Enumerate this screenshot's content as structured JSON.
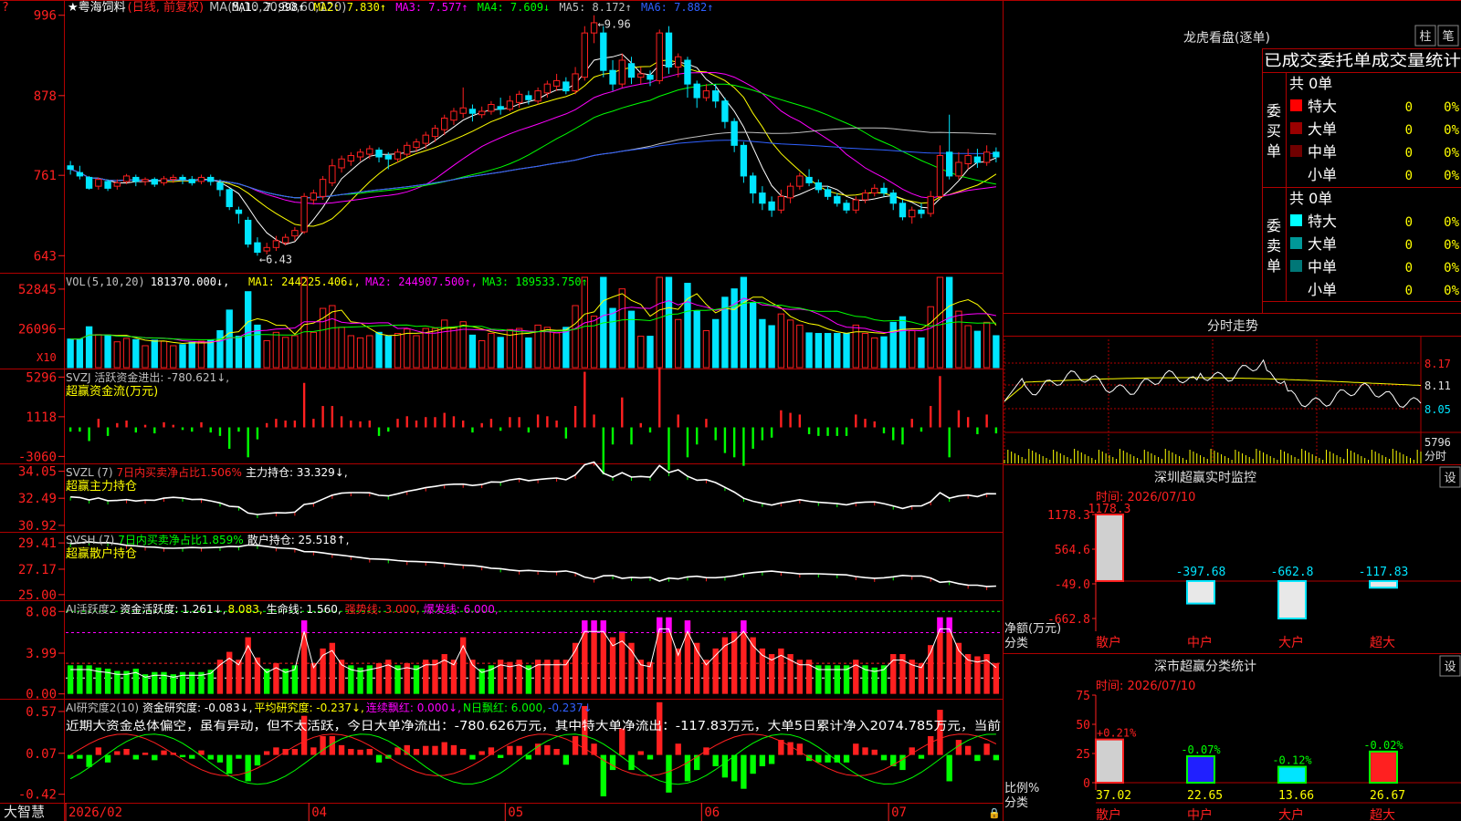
{
  "colors": {
    "up": "#ff2020",
    "down": "#00e5ff",
    "grid": "#b00000",
    "text": "#c0c0c0",
    "yellow": "#ffff00",
    "magenta": "#ff00ff",
    "green": "#00ff00",
    "blue": "#3060ff",
    "white": "#ffffff"
  },
  "main_chart": {
    "title_star": "★",
    "name": "粤海饲料",
    "mode": "(日线, 前复权)",
    "ma_header": "MA(5,10,20,30,60,120)",
    "ma_values": [
      {
        "label": "MA1: 7.998↑",
        "color": "#ffffff"
      },
      {
        "label": "MA2: 7.830↑",
        "color": "#ffff00"
      },
      {
        "label": "MA3: 7.577↑",
        "color": "#ff00ff"
      },
      {
        "label": "MA4: 7.609↓",
        "color": "#00ff00"
      },
      {
        "label": "MA5: 8.172↑",
        "color": "#c0c0c0"
      },
      {
        "label": "MA6: 7.882↑",
        "color": "#3060ff"
      }
    ],
    "y_ticks": [
      "996",
      "878",
      "761",
      "643"
    ],
    "y_values": [
      9.96,
      8.78,
      7.61,
      6.43
    ],
    "high_label": "9.96",
    "low_label": "6.43",
    "candles": [
      [
        7.75,
        7.7,
        7.82,
        7.62
      ],
      [
        7.65,
        7.6,
        7.75,
        7.55
      ],
      [
        7.58,
        7.42,
        7.6,
        7.4
      ],
      [
        7.45,
        7.55,
        7.58,
        7.4
      ],
      [
        7.52,
        7.42,
        7.55,
        7.38
      ],
      [
        7.45,
        7.5,
        7.55,
        7.4
      ],
      [
        7.52,
        7.6,
        7.63,
        7.48
      ],
      [
        7.58,
        7.52,
        7.62,
        7.45
      ],
      [
        7.52,
        7.55,
        7.58,
        7.46
      ],
      [
        7.55,
        7.48,
        7.58,
        7.44
      ],
      [
        7.5,
        7.56,
        7.6,
        7.46
      ],
      [
        7.55,
        7.58,
        7.62,
        7.5
      ],
      [
        7.58,
        7.55,
        7.62,
        7.48
      ],
      [
        7.55,
        7.5,
        7.6,
        7.46
      ],
      [
        7.52,
        7.58,
        7.62,
        7.48
      ],
      [
        7.58,
        7.52,
        7.62,
        7.46
      ],
      [
        7.5,
        7.4,
        7.55,
        7.3
      ],
      [
        7.4,
        7.15,
        7.42,
        7.1
      ],
      [
        7.1,
        7.05,
        7.15,
        6.9
      ],
      [
        6.95,
        6.6,
        7.0,
        6.55
      ],
      [
        6.62,
        6.48,
        6.7,
        6.43
      ],
      [
        6.5,
        6.55,
        6.62,
        6.45
      ],
      [
        6.55,
        6.65,
        6.72,
        6.5
      ],
      [
        6.62,
        6.7,
        6.75,
        6.58
      ],
      [
        6.72,
        6.8,
        6.85,
        6.65
      ],
      [
        6.78,
        7.3,
        7.35,
        6.75
      ],
      [
        7.25,
        7.35,
        7.4,
        7.18
      ],
      [
        7.3,
        7.55,
        7.6,
        7.25
      ],
      [
        7.5,
        7.75,
        7.85,
        7.45
      ],
      [
        7.72,
        7.85,
        7.9,
        7.65
      ],
      [
        7.82,
        7.9,
        7.95,
        7.75
      ],
      [
        7.88,
        7.95,
        8.0,
        7.82
      ],
      [
        7.92,
        8.0,
        8.05,
        7.85
      ],
      [
        7.98,
        7.88,
        8.02,
        7.8
      ],
      [
        7.9,
        7.85,
        7.95,
        7.7
      ],
      [
        7.85,
        7.95,
        8.0,
        7.8
      ],
      [
        7.92,
        8.05,
        8.1,
        7.88
      ],
      [
        8.02,
        8.1,
        8.15,
        7.95
      ],
      [
        8.08,
        8.2,
        8.25,
        8.0
      ],
      [
        8.18,
        8.3,
        8.35,
        8.1
      ],
      [
        8.28,
        8.45,
        8.5,
        8.2
      ],
      [
        8.42,
        8.55,
        8.6,
        8.35
      ],
      [
        8.52,
        8.6,
        8.9,
        8.45
      ],
      [
        8.58,
        8.52,
        8.65,
        8.4
      ],
      [
        8.5,
        8.55,
        8.62,
        8.45
      ],
      [
        8.55,
        8.65,
        8.7,
        8.5
      ],
      [
        8.62,
        8.58,
        8.75,
        8.5
      ],
      [
        8.58,
        8.7,
        8.78,
        8.55
      ],
      [
        8.68,
        8.8,
        8.85,
        8.6
      ],
      [
        8.78,
        8.72,
        8.85,
        8.65
      ],
      [
        8.7,
        8.85,
        8.9,
        8.65
      ],
      [
        8.82,
        8.95,
        9.0,
        8.75
      ],
      [
        8.92,
        9.0,
        9.1,
        8.85
      ],
      [
        8.98,
        8.85,
        9.05,
        8.8
      ],
      [
        8.85,
        9.1,
        9.2,
        8.8
      ],
      [
        9.05,
        9.7,
        9.8,
        9.0
      ],
      [
        9.7,
        9.85,
        9.96,
        9.55
      ],
      [
        9.7,
        9.15,
        9.8,
        9.05
      ],
      [
        9.15,
        8.95,
        9.3,
        8.85
      ],
      [
        8.95,
        9.3,
        9.4,
        8.9
      ],
      [
        9.25,
        9.05,
        9.35,
        8.95
      ],
      [
        9.05,
        9.1,
        9.2,
        8.95
      ],
      [
        9.08,
        9.02,
        9.15,
        8.92
      ],
      [
        9.0,
        9.7,
        9.75,
        8.95
      ],
      [
        9.7,
        9.2,
        9.8,
        9.1
      ],
      [
        9.2,
        9.35,
        9.4,
        9.05
      ],
      [
        9.3,
        8.95,
        9.35,
        8.75
      ],
      [
        8.95,
        8.75,
        9.0,
        8.6
      ],
      [
        8.75,
        8.85,
        8.95,
        8.7
      ],
      [
        8.85,
        8.7,
        8.95,
        8.6
      ],
      [
        8.7,
        8.4,
        8.75,
        8.3
      ],
      [
        8.4,
        8.05,
        8.45,
        7.95
      ],
      [
        8.05,
        7.6,
        8.1,
        7.5
      ],
      [
        7.6,
        7.35,
        7.65,
        7.2
      ],
      [
        7.35,
        7.2,
        7.45,
        7.1
      ],
      [
        7.22,
        7.1,
        7.3,
        7.0
      ],
      [
        7.1,
        7.3,
        7.4,
        7.05
      ],
      [
        7.28,
        7.45,
        7.5,
        7.2
      ],
      [
        7.45,
        7.6,
        7.65,
        7.4
      ],
      [
        7.58,
        7.5,
        7.7,
        7.45
      ],
      [
        7.5,
        7.4,
        7.55,
        7.35
      ],
      [
        7.4,
        7.3,
        7.45,
        7.25
      ],
      [
        7.3,
        7.2,
        7.35,
        7.15
      ],
      [
        7.2,
        7.1,
        7.25,
        7.05
      ],
      [
        7.1,
        7.25,
        7.3,
        7.05
      ],
      [
        7.25,
        7.35,
        7.4,
        7.2
      ],
      [
        7.35,
        7.42,
        7.48,
        7.3
      ],
      [
        7.42,
        7.35,
        7.5,
        7.3
      ],
      [
        7.35,
        7.2,
        7.4,
        7.1
      ],
      [
        7.2,
        7.0,
        7.25,
        6.95
      ],
      [
        7.0,
        7.1,
        7.15,
        6.9
      ],
      [
        7.1,
        7.05,
        7.2,
        6.98
      ],
      [
        7.05,
        7.3,
        7.38,
        7.0
      ],
      [
        7.3,
        7.9,
        8.05,
        7.25
      ],
      [
        7.95,
        7.6,
        8.5,
        7.55
      ],
      [
        7.6,
        7.8,
        7.95,
        7.55
      ],
      [
        7.78,
        7.9,
        8.0,
        7.7
      ],
      [
        7.88,
        7.8,
        8.0,
        7.72
      ],
      [
        7.8,
        7.95,
        8.05,
        7.75
      ],
      [
        7.95,
        7.88,
        8.02,
        7.8
      ]
    ],
    "price_range": [
      6.3,
      10.05
    ],
    "x_labels": [
      {
        "text": "2026/02",
        "i": 0
      },
      {
        "text": "04",
        "i": 26
      },
      {
        "text": "05",
        "i": 47
      },
      {
        "text": "06",
        "i": 68
      },
      {
        "text": "07",
        "i": 88
      }
    ],
    "x_bottom_left": "大智慧"
  },
  "vol_panel": {
    "header_label": "VOL(5,10,20)",
    "value": "181370.000↓,",
    "ma": [
      {
        "label": "MA1: 244225.406↓,",
        "color": "#ffff00"
      },
      {
        "label": "MA2: 244907.500↑,",
        "color": "#ff00ff"
      },
      {
        "label": "MA3: 189533.750↑",
        "color": "#00ff00"
      }
    ],
    "y_ticks": [
      "52845",
      "26096"
    ],
    "y_values": [
      52845,
      26096
    ],
    "unit": "X10",
    "max": 62000
  },
  "svzj_panel": {
    "header": "SVZJ  活跃资金进出: -780.621↓,",
    "subtitle": "超赢资金流(万元)",
    "y_ticks": [
      "5296",
      "1118",
      "-3060"
    ],
    "y_values": [
      5296,
      1118,
      -3060
    ],
    "range": [
      -3600,
      6000
    ]
  },
  "svzl_panel": {
    "header_a": "SVZL (7)",
    "header_b": "7日内买卖净占比1.506%",
    "header_c": "主力持仓: 33.329↓,",
    "subtitle": "超赢主力持仓",
    "y_ticks": [
      "34.05",
      "32.49",
      "30.92"
    ],
    "y_values": [
      34.05,
      32.49,
      30.92
    ],
    "range": [
      30.6,
      34.4
    ]
  },
  "svsh_panel": {
    "header_a": "SVSH (7)",
    "header_b": "7日内买卖净占比1.859%",
    "header_c": "散户持仓: 25.518↑,",
    "subtitle": "超赢散户持仓",
    "y_ticks": [
      "29.41",
      "27.17",
      "25.00"
    ],
    "y_values": [
      29.41,
      27.17,
      25.0
    ],
    "range": [
      24.6,
      30.2
    ]
  },
  "ai_active_panel": {
    "header_a": "AI活跃度2",
    "header_b": "资金活跃度: 1.261↓,",
    "header_c": "8.083,",
    "header_d": "生命线: 1.560,",
    "header_e": "强势线: 3.000,",
    "header_f": "爆发线: 6.000,",
    "y_ticks": [
      "8.08",
      "3.99",
      "0.00"
    ],
    "y_values": [
      8.08,
      3.99,
      0
    ],
    "range": [
      -0.3,
      9.0
    ]
  },
  "ai_research_panel": {
    "header_a": "AI研究度2(10)",
    "header_b": "资金研究度: -0.083↓,",
    "header_c": "平均研究度: -0.237↓,",
    "header_d": "连续飘红: 0.000↓,",
    "header_e": "N日飘红: 6.000,",
    "header_f": "-0.237↓",
    "comment": "近期大资金总体偏空，虽有异动，但不太活跃，今日大单净流出：-780.626万元，其中特大单净流出：-117.83万元，大单5日累计净入2074.785万元，当前",
    "y_ticks": [
      "0.57",
      "0.07",
      "-0.42"
    ],
    "y_values": [
      0.57,
      0.07,
      -0.42
    ],
    "range": [
      -0.5,
      0.7
    ]
  },
  "right_panel": {
    "dragon_title": "龙虎看盘(逐单)",
    "tab_a": "柱",
    "tab_b": "笔",
    "stats_title": "已成交委托单成交量统计",
    "buy": {
      "label": "委买单",
      "total": "共 0单",
      "rows": [
        {
          "name": "特大",
          "count": "0",
          "pct": "0%",
          "color": "#ff0000"
        },
        {
          "name": "大单",
          "count": "0",
          "pct": "0%",
          "color": "#9a0000"
        },
        {
          "name": "中单",
          "count": "0",
          "pct": "0%",
          "color": "#700000"
        },
        {
          "name": "小单",
          "count": "0",
          "pct": "0%",
          "color": ""
        }
      ]
    },
    "sell": {
      "label": "委卖单",
      "total": "共 0单",
      "rows": [
        {
          "name": "特大",
          "count": "0",
          "pct": "0%",
          "color": "#00ffff"
        },
        {
          "name": "大单",
          "count": "0",
          "pct": "0%",
          "color": "#009999"
        },
        {
          "name": "中单",
          "count": "0",
          "pct": "0%",
          "color": "#007777"
        },
        {
          "name": "小单",
          "count": "0",
          "pct": "0%",
          "color": ""
        }
      ]
    },
    "intraday_title": "分时走势",
    "intraday_y": [
      "8.17",
      "8.11",
      "8.05"
    ],
    "intraday_vol": "5796",
    "intraday_vol_unit": "分时",
    "monitor_title": "深圳超赢实时监控",
    "monitor_settings": "设",
    "monitor_time": "时间: 2026/07/10",
    "monitor_y": [
      "1178.3",
      "564.6",
      "-49.0",
      "-662.8"
    ],
    "monitor_unit_a": "净额(万元)",
    "monitor_unit_b": "分类",
    "monitor_bars": [
      {
        "label": "散户",
        "value": 1178.3,
        "text": "1178.3"
      },
      {
        "label": "中户",
        "value": -397.68,
        "text": "-397.68"
      },
      {
        "label": "大户",
        "value": -662.8,
        "text": "-662.8"
      },
      {
        "label": "超大",
        "value": -117.83,
        "text": "-117.83"
      }
    ],
    "monitor_range": [
      -662.8,
      1178.3
    ],
    "class_title": "深市超赢分类统计",
    "class_settings": "设",
    "class_time": "时间: 2026/07/10",
    "class_y": [
      "75",
      "50",
      "25",
      "0"
    ],
    "class_unit_a": "比例%",
    "class_unit_b": "分类",
    "class_bars": [
      {
        "label": "散户",
        "value": 37.02,
        "text": "37.02",
        "change": "+0.21%",
        "color": "#ff2020",
        "fill": "#d0d0d0"
      },
      {
        "label": "中户",
        "value": 22.65,
        "text": "22.65",
        "change": "-0.07%",
        "color": "#00ff00",
        "fill": "#2020ff"
      },
      {
        "label": "大户",
        "value": 13.66,
        "text": "13.66",
        "change": "-0.12%",
        "color": "#00ff00",
        "fill": "#00e5ff"
      },
      {
        "label": "超大",
        "value": 26.67,
        "text": "26.67",
        "change": "-0.02%",
        "color": "#00ff00",
        "fill": "#ff2020"
      }
    ]
  }
}
